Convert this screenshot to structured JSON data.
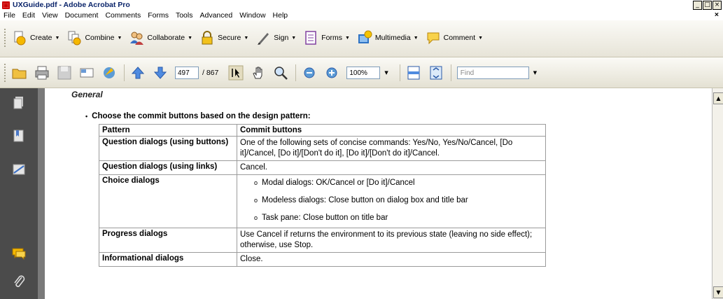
{
  "window": {
    "title": "UXGuide.pdf - Adobe Acrobat Pro",
    "controls": [
      "_",
      "□",
      "×"
    ]
  },
  "menu": {
    "items": [
      "File",
      "Edit",
      "View",
      "Document",
      "Comments",
      "Forms",
      "Tools",
      "Advanced",
      "Window",
      "Help"
    ],
    "close_doc": "×"
  },
  "tasks_toolbar": {
    "buttons": [
      {
        "label": "Create",
        "icon": "create-pdf-icon"
      },
      {
        "label": "Combine",
        "icon": "combine-icon"
      },
      {
        "label": "Collaborate",
        "icon": "collaborate-icon"
      },
      {
        "label": "Secure",
        "icon": "lock-icon"
      },
      {
        "label": "Sign",
        "icon": "pen-icon"
      },
      {
        "label": "Forms",
        "icon": "form-icon"
      },
      {
        "label": "Multimedia",
        "icon": "multimedia-icon"
      },
      {
        "label": "Comment",
        "icon": "comment-icon"
      }
    ]
  },
  "nav_toolbar": {
    "page_current": "497",
    "page_total": "/ 867",
    "zoom": "100%",
    "find_placeholder": "Find"
  },
  "document": {
    "section_heading": "General",
    "bullet": "Choose the commit buttons based on the design pattern:",
    "table": {
      "headers": [
        "Pattern",
        "Commit buttons"
      ],
      "rows": [
        {
          "pattern": "Question dialogs (using buttons)",
          "buttons": "One of the following sets of concise commands: Yes/No, Yes/No/Cancel, [Do it]/Cancel, [Do it]/[Don't do it], [Do it]/[Don't do it]/Cancel."
        },
        {
          "pattern": "Question dialogs (using links)",
          "buttons": "Cancel."
        },
        {
          "pattern": "Choice dialogs",
          "list": [
            "Modal dialogs: OK/Cancel or [Do it]/Cancel",
            "Modeless dialogs: Close button on dialog box and title bar",
            "Task pane: Close button on title bar"
          ]
        },
        {
          "pattern": "Progress dialogs",
          "buttons": "Use Cancel if returns the environment to its previous state (leaving no side effect); otherwise, use Stop."
        },
        {
          "pattern": "Informational dialogs",
          "buttons": "Close."
        }
      ]
    }
  },
  "colors": {
    "nav_pane": "#4b4b4b",
    "doc_gutter": "#7a7a7a",
    "title_text": "#0a246a",
    "toolbar": "#ece9d8"
  }
}
